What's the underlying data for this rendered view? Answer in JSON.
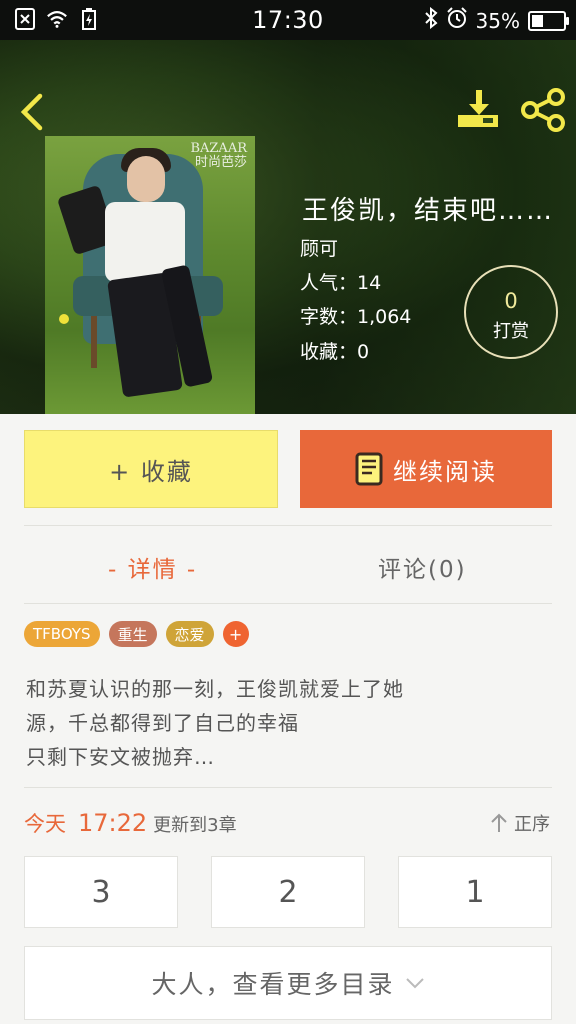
{
  "status_bar": {
    "time": "17:30",
    "battery": "35%",
    "battery_level": 0.35
  },
  "header": {
    "back_icon": "chevron-left-icon",
    "download_icon": "download-icon",
    "share_icon": "share-icon"
  },
  "book": {
    "cover_brand_line1": "BAZAAR",
    "cover_brand_line2": "时尚芭莎",
    "title": "王俊凯，结束吧……",
    "author": "顾可",
    "popularity": "人气：14",
    "word_count": "字数：1,064",
    "favorites": "收藏：0",
    "tip_count": "0",
    "tip_label": "打赏"
  },
  "actions": {
    "favorite_label": "+ 收藏",
    "continue_label": "继续阅读"
  },
  "tabs": {
    "detail": "- 详情 -",
    "comments": "评论(0)"
  },
  "tags": [
    "TFBOYS",
    "重生",
    "恋爱",
    "+"
  ],
  "description": {
    "line1": "和苏夏认识的那一刻，王俊凯就爱上了她",
    "line2": "源，千总都得到了自己的幸福",
    "line3": "只剩下安文被抛弃…"
  },
  "update": {
    "day": "今天",
    "time": "17:22",
    "text": "更新到3章",
    "sort_label": "正序"
  },
  "chapters": [
    "3",
    "2",
    "1"
  ],
  "more_catalog": "大人，查看更多目录",
  "colors": {
    "accent": "#e8683a",
    "favorite_bg": "#fdf37d",
    "tip_gold": "#f0ea9c"
  }
}
